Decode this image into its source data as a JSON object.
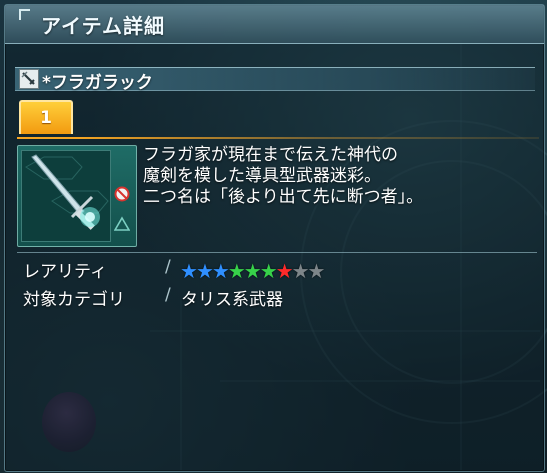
{
  "window": {
    "title": "アイテム詳細"
  },
  "item": {
    "name": "*フラガラック",
    "tab_label": "1",
    "description": [
      "フラガ家が現在まで伝えた神代の",
      "魔剣を模した導具型武器迷彩。",
      "二つ名は「後より出て先に断つ者」。"
    ]
  },
  "properties": {
    "rarity_label": "レアリティ",
    "rarity_value": 7,
    "rarity_max": 9,
    "category_label": "対象カテゴリ",
    "category_value": "タリス系武器",
    "separator": "/"
  },
  "colors": {
    "star_low": "#2f8fff",
    "star_mid": "#37d24a",
    "star_high": "#ff2a2a",
    "star_empty": "#7d8589",
    "tab": "#f5a523"
  },
  "icons": {
    "item_type": "sword-camo-icon",
    "no_trade": "prohibited-icon",
    "warning": "triangle-icon"
  }
}
